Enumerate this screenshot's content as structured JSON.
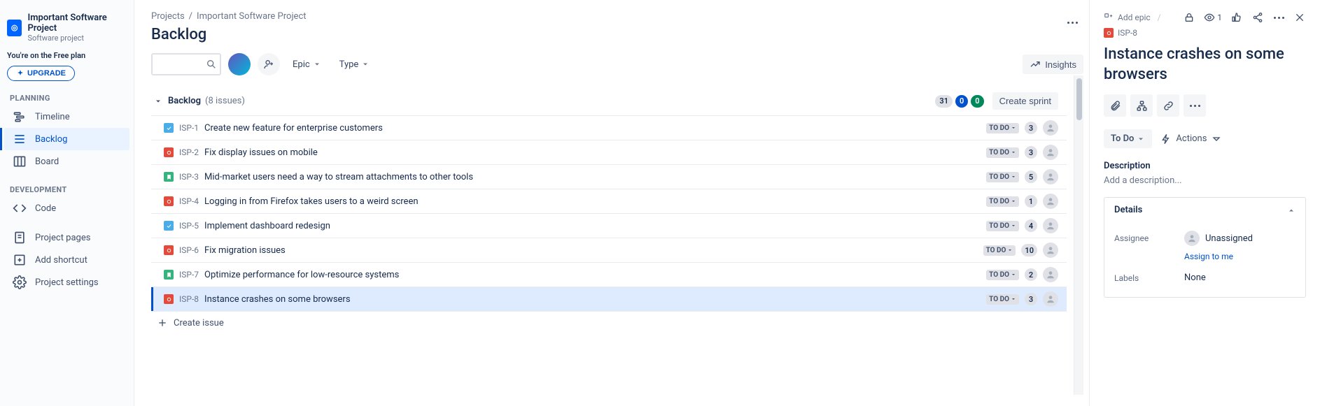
{
  "sidebar": {
    "project_title": "Important Software Project",
    "project_subtitle": "Software project",
    "plan_note": "You're on the Free plan",
    "upgrade_label": "UPGRADE",
    "sections": {
      "planning": "PLANNING",
      "development": "DEVELOPMENT"
    },
    "nav": {
      "timeline": "Timeline",
      "backlog": "Backlog",
      "board": "Board",
      "code": "Code",
      "project_pages": "Project pages",
      "add_shortcut": "Add shortcut",
      "project_settings": "Project settings"
    }
  },
  "header": {
    "breadcrumb_projects": "Projects",
    "breadcrumb_project": "Important Software Project",
    "page_title": "Backlog",
    "epic_label": "Epic",
    "type_label": "Type",
    "insights_label": "Insights"
  },
  "group": {
    "name": "Backlog",
    "count_label": "(8 issues)",
    "totals": {
      "gray": "31",
      "blue": "0",
      "green": "0"
    },
    "create_sprint": "Create sprint"
  },
  "issues": [
    {
      "type": "task",
      "key": "ISP-1",
      "summary": "Create new feature for enterprise customers",
      "status": "TO DO",
      "estimate": "3"
    },
    {
      "type": "bug",
      "key": "ISP-2",
      "summary": "Fix display issues on mobile",
      "status": "TO DO",
      "estimate": "3"
    },
    {
      "type": "story",
      "key": "ISP-3",
      "summary": "Mid-market users need a way to stream attachments to other tools",
      "status": "TO DO",
      "estimate": "5"
    },
    {
      "type": "bug",
      "key": "ISP-4",
      "summary": "Logging in from Firefox takes users to a weird screen",
      "status": "TO DO",
      "estimate": "1"
    },
    {
      "type": "task",
      "key": "ISP-5",
      "summary": "Implement dashboard redesign",
      "status": "TO DO",
      "estimate": "4"
    },
    {
      "type": "bug",
      "key": "ISP-6",
      "summary": "Fix migration issues",
      "status": "TO DO",
      "estimate": "10"
    },
    {
      "type": "story",
      "key": "ISP-7",
      "summary": "Optimize performance for low-resource systems",
      "status": "TO DO",
      "estimate": "2"
    },
    {
      "type": "bug",
      "key": "ISP-8",
      "summary": "Instance crashes on some browsers",
      "status": "TO DO",
      "estimate": "3",
      "selected": true
    }
  ],
  "create_issue_label": "Create issue",
  "detail": {
    "add_epic": "Add epic",
    "key": "ISP-8",
    "title": "Instance crashes on some browsers",
    "watch_count": "1",
    "status_label": "To Do",
    "actions_label": "Actions",
    "description_label": "Description",
    "description_placeholder": "Add a description...",
    "details_label": "Details",
    "assignee_label": "Assignee",
    "assignee_value": "Unassigned",
    "assign_to_me": "Assign to me",
    "labels_label": "Labels",
    "labels_value": "None"
  }
}
